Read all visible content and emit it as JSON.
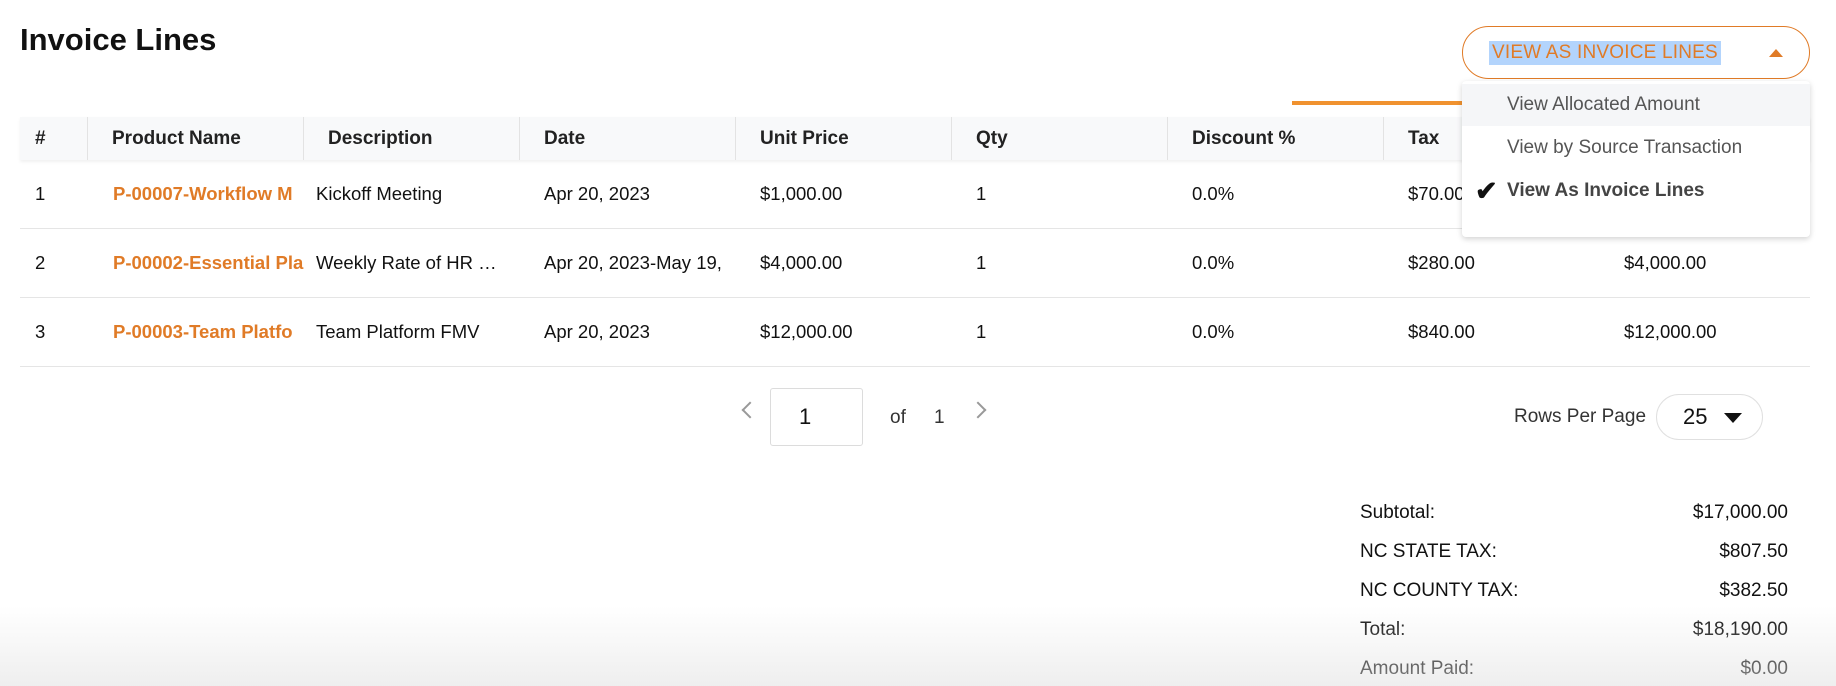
{
  "page": {
    "title": "Invoice Lines"
  },
  "view_select": {
    "selected_label": "VIEW AS INVOICE LINES",
    "options": [
      {
        "label": "View Allocated Amount",
        "state": "hover"
      },
      {
        "label": "View by Source Transaction",
        "state": "normal"
      },
      {
        "label": "View As Invoice Lines",
        "state": "selected"
      }
    ],
    "check_glyph": "✔"
  },
  "colors": {
    "accent": "#e07b27",
    "arrow": "#f0922f",
    "selection_highlight": "#b3d4fc"
  },
  "table": {
    "headers": [
      "#",
      "Product Name",
      "Description",
      "Date",
      "Unit Price",
      "Qty",
      "Discount %",
      "Tax",
      ""
    ],
    "rows": [
      {
        "num": "1",
        "product": "P-00007-Workflow M",
        "description": "Kickoff Meeting",
        "date": "Apr 20, 2023",
        "unit_price": "$1,000.00",
        "qty": "1",
        "discount": "0.0%",
        "tax": "$70.00",
        "amount": ""
      },
      {
        "num": "2",
        "product": "P-00002-Essential Pla",
        "description": "Weekly Rate of HR …",
        "date": "Apr 20, 2023-May 19,",
        "unit_price": "$4,000.00",
        "qty": "1",
        "discount": "0.0%",
        "tax": "$280.00",
        "amount": "$4,000.00"
      },
      {
        "num": "3",
        "product": "P-00003-Team Platfo",
        "description": "Team Platform FMV",
        "date": "Apr 20, 2023",
        "unit_price": "$12,000.00",
        "qty": "1",
        "discount": "0.0%",
        "tax": "$840.00",
        "amount": "$12,000.00"
      }
    ]
  },
  "pagination": {
    "current_page": "1",
    "of_label": "of",
    "total_pages": "1",
    "rows_per_page_label": "Rows Per Page",
    "rows_per_page": "25"
  },
  "totals": [
    {
      "label": "Subtotal:",
      "value": "$17,000.00"
    },
    {
      "label": "NC STATE TAX:",
      "value": "$807.50"
    },
    {
      "label": "NC COUNTY TAX:",
      "value": "$382.50"
    },
    {
      "label": "Total:",
      "value": "$18,190.00"
    },
    {
      "label": "Amount Paid:",
      "value": "$0.00"
    }
  ]
}
